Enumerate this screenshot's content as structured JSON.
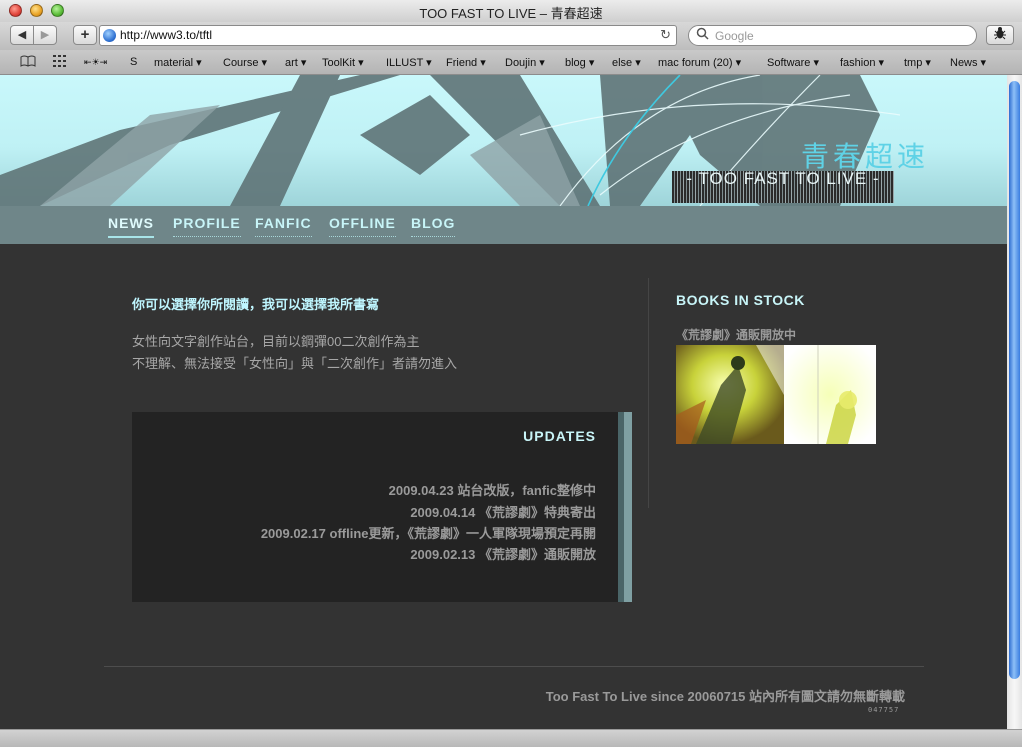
{
  "window": {
    "title": "TOO FAST TO LIVE – 青春超速"
  },
  "toolbar": {
    "back_icon": "◀",
    "forward_icon": "▶",
    "add_label": "+",
    "url": "http://www3.to/tftl",
    "reload_icon": "↻",
    "search_placeholder": "Google",
    "search_icon": "🔍"
  },
  "bookmarks": {
    "items": [
      "S",
      "material ▾",
      "Course ▾",
      "art ▾",
      "ToolKit ▾",
      "ILLUST ▾",
      "Friend ▾",
      "Doujin ▾",
      "blog ▾",
      "else ▾",
      "mac forum (20) ▾",
      "Software ▾",
      "fashion ▾",
      "tmp ▾",
      "News ▾"
    ],
    "misc_label": "⇤☀⇥"
  },
  "header": {
    "title_cjk": "青春超速",
    "title_en": "- TOO FAST TO LIVE -"
  },
  "nav": {
    "items": [
      "NEWS",
      "PROFILE",
      "FANFIC",
      "OFFLINE",
      "BLOG"
    ],
    "active": "NEWS"
  },
  "main": {
    "tagline": "你可以選擇你所閱讀，我可以選擇我所書寫",
    "intro_1": "女性向文字創作站台，目前以鋼彈00二次創作為主",
    "intro_2": "不理解、無法接受「女性向」與「二次創作」者請勿進入"
  },
  "updates": {
    "title": "UPDATES",
    "items": [
      "2009.04.23 站台改版，fanfic整修中",
      "2009.04.14 《荒謬劇》特典寄出",
      "2009.02.17 offline更新，《荒謬劇》一人軍隊現場預定再開",
      "2009.02.13 《荒謬劇》通販開放"
    ]
  },
  "sidebar": {
    "title": "BOOKS IN STOCK",
    "subtitle": "《荒謬劇》通販開放中"
  },
  "footer": {
    "text": "Too Fast To Live since 20060715 站內所有圖文請勿無斷轉載",
    "counter": "047757"
  },
  "colors": {
    "accent": "#c8f5f8",
    "page_bg": "#333333",
    "header_bg": "#c9f8fb",
    "nav_bg": "#6f8689"
  }
}
